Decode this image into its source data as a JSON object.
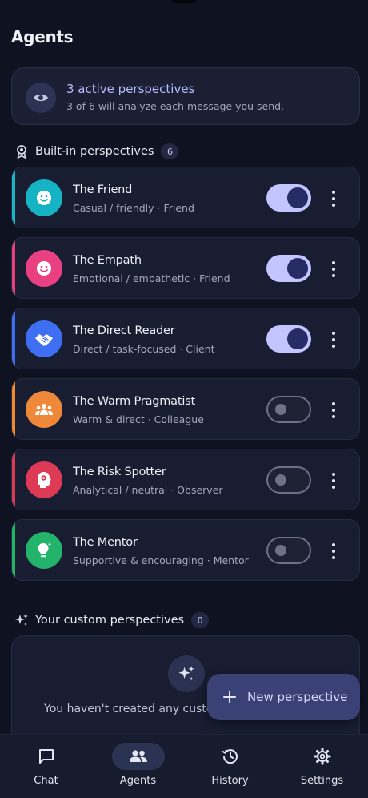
{
  "page": {
    "title": "Agents"
  },
  "summary": {
    "title": "3 active perspectives",
    "subtitle": "3 of 6 will analyze each message you send.",
    "icon": "eye-icon"
  },
  "builtin": {
    "label": "Built-in perspectives",
    "count": "6",
    "icon": "award-badge-icon",
    "agents": [
      {
        "name": "The Friend",
        "desc": "Casual / friendly · Friend",
        "enabled": true,
        "accent": "#1bb6c4",
        "avatar_color": "#16b3c4",
        "icon": "smile-icon"
      },
      {
        "name": "The Empath",
        "desc": "Emotional / empathetic · Friend",
        "enabled": true,
        "accent": "#e5417d",
        "avatar_color": "#e84080",
        "icon": "smile-icon"
      },
      {
        "name": "The Direct Reader",
        "desc": "Direct / task-focused · Client",
        "enabled": true,
        "accent": "#3f6ef0",
        "avatar_color": "#3e6ef2",
        "icon": "handshake-icon"
      },
      {
        "name": "The Warm Pragmatist",
        "desc": "Warm & direct · Colleague",
        "enabled": false,
        "accent": "#f08a32",
        "avatar_color": "#f0883a",
        "icon": "group-icon"
      },
      {
        "name": "The Risk Spotter",
        "desc": "Analytical / neutral · Observer",
        "enabled": false,
        "accent": "#d93a55",
        "avatar_color": "#dc3a55",
        "icon": "brain-head-icon"
      },
      {
        "name": "The Mentor",
        "desc": "Supportive & encouraging · Mentor",
        "enabled": false,
        "accent": "#22b568",
        "avatar_color": "#23b36a",
        "icon": "lightbulb-icon"
      }
    ]
  },
  "custom": {
    "label": "Your custom perspectives",
    "count": "0",
    "icon": "sparkles-icon",
    "empty_text": "You haven't created any custo"
  },
  "fab": {
    "label": "New perspective",
    "icon": "plus-icon"
  },
  "nav": {
    "items": [
      {
        "label": "Chat",
        "icon": "chat-icon",
        "active": false
      },
      {
        "label": "Agents",
        "icon": "people-icon",
        "active": true
      },
      {
        "label": "History",
        "icon": "history-icon",
        "active": false
      },
      {
        "label": "Settings",
        "icon": "gear-icon",
        "active": false
      }
    ]
  }
}
